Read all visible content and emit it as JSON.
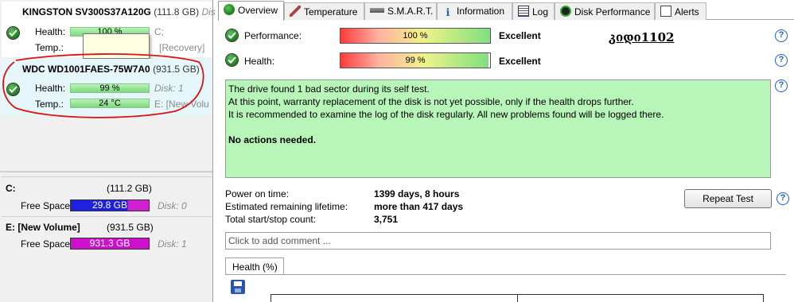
{
  "left_pane": {
    "disks": [
      {
        "model": "KINGSTON SV300S37A120G",
        "size": "(111.8 GB)",
        "side_title": "Dis",
        "health_label": "Health:",
        "health_value": "100 %",
        "temp_label": "Temp.:",
        "drive_letters": "C;",
        "extra": "[Recovery]"
      },
      {
        "model": "WDC WD1001FAES-75W7A0",
        "size": "(931.5 GB)",
        "health_label": "Health:",
        "health_value": "99 %",
        "disk_index": "Disk: 1",
        "temp_label": "Temp.:",
        "temp_value": "24 °C",
        "drive_letters": "E: [New Volu"
      }
    ],
    "volumes": [
      {
        "name": "C:",
        "size": "(111.2 GB)",
        "free_label": "Free Space",
        "free_value": "29.8 GB",
        "disk_index": "Disk: 0",
        "fill": 0.27,
        "color": "#1a1aff"
      },
      {
        "name": "E: [New Volume]",
        "size": "(931.5 GB)",
        "free_label": "Free Space",
        "free_value": "931.3 GB",
        "disk_index": "Disk: 1",
        "fill": 1.0,
        "color": "#cc10cc"
      }
    ]
  },
  "tabs": [
    {
      "label": "Overview",
      "icon": "ok-icon",
      "active": true
    },
    {
      "label": "Temperature",
      "icon": "thermometer-icon"
    },
    {
      "label": "S.M.A.R.T.",
      "icon": "smart-icon"
    },
    {
      "label": "Information",
      "icon": "info-icon"
    },
    {
      "label": "Log",
      "icon": "log-icon"
    },
    {
      "label": "Disk Performance",
      "icon": "gauge-icon"
    },
    {
      "label": "Alerts",
      "icon": "alerts-icon"
    }
  ],
  "overview": {
    "performance_label": "Performance:",
    "performance_value": "100 %",
    "performance_rating": "Excellent",
    "health_label": "Health:",
    "health_value": "99 %",
    "health_rating": "Excellent",
    "watermark_text": "კიდი1102",
    "message_lines": [
      "The drive found 1 bad sector during its self test.",
      "At this point, warranty replacement of the disk is not yet possible, only if the health drops further.",
      "It is recommended to examine the log of the disk regularly. All new problems found will be logged there."
    ],
    "message_bold": "No actions needed.",
    "power_on_label": "Power on time:",
    "power_on_value": "1399 days, 8 hours",
    "remaining_label": "Estimated remaining lifetime:",
    "remaining_value": "more than 417 days",
    "startstop_label": "Total start/stop count:",
    "startstop_value": "3,751",
    "repeat_button": "Repeat Test",
    "comment_placeholder": "Click to add comment ...",
    "subtab_label": "Health (%)",
    "help_glyph": "?"
  }
}
